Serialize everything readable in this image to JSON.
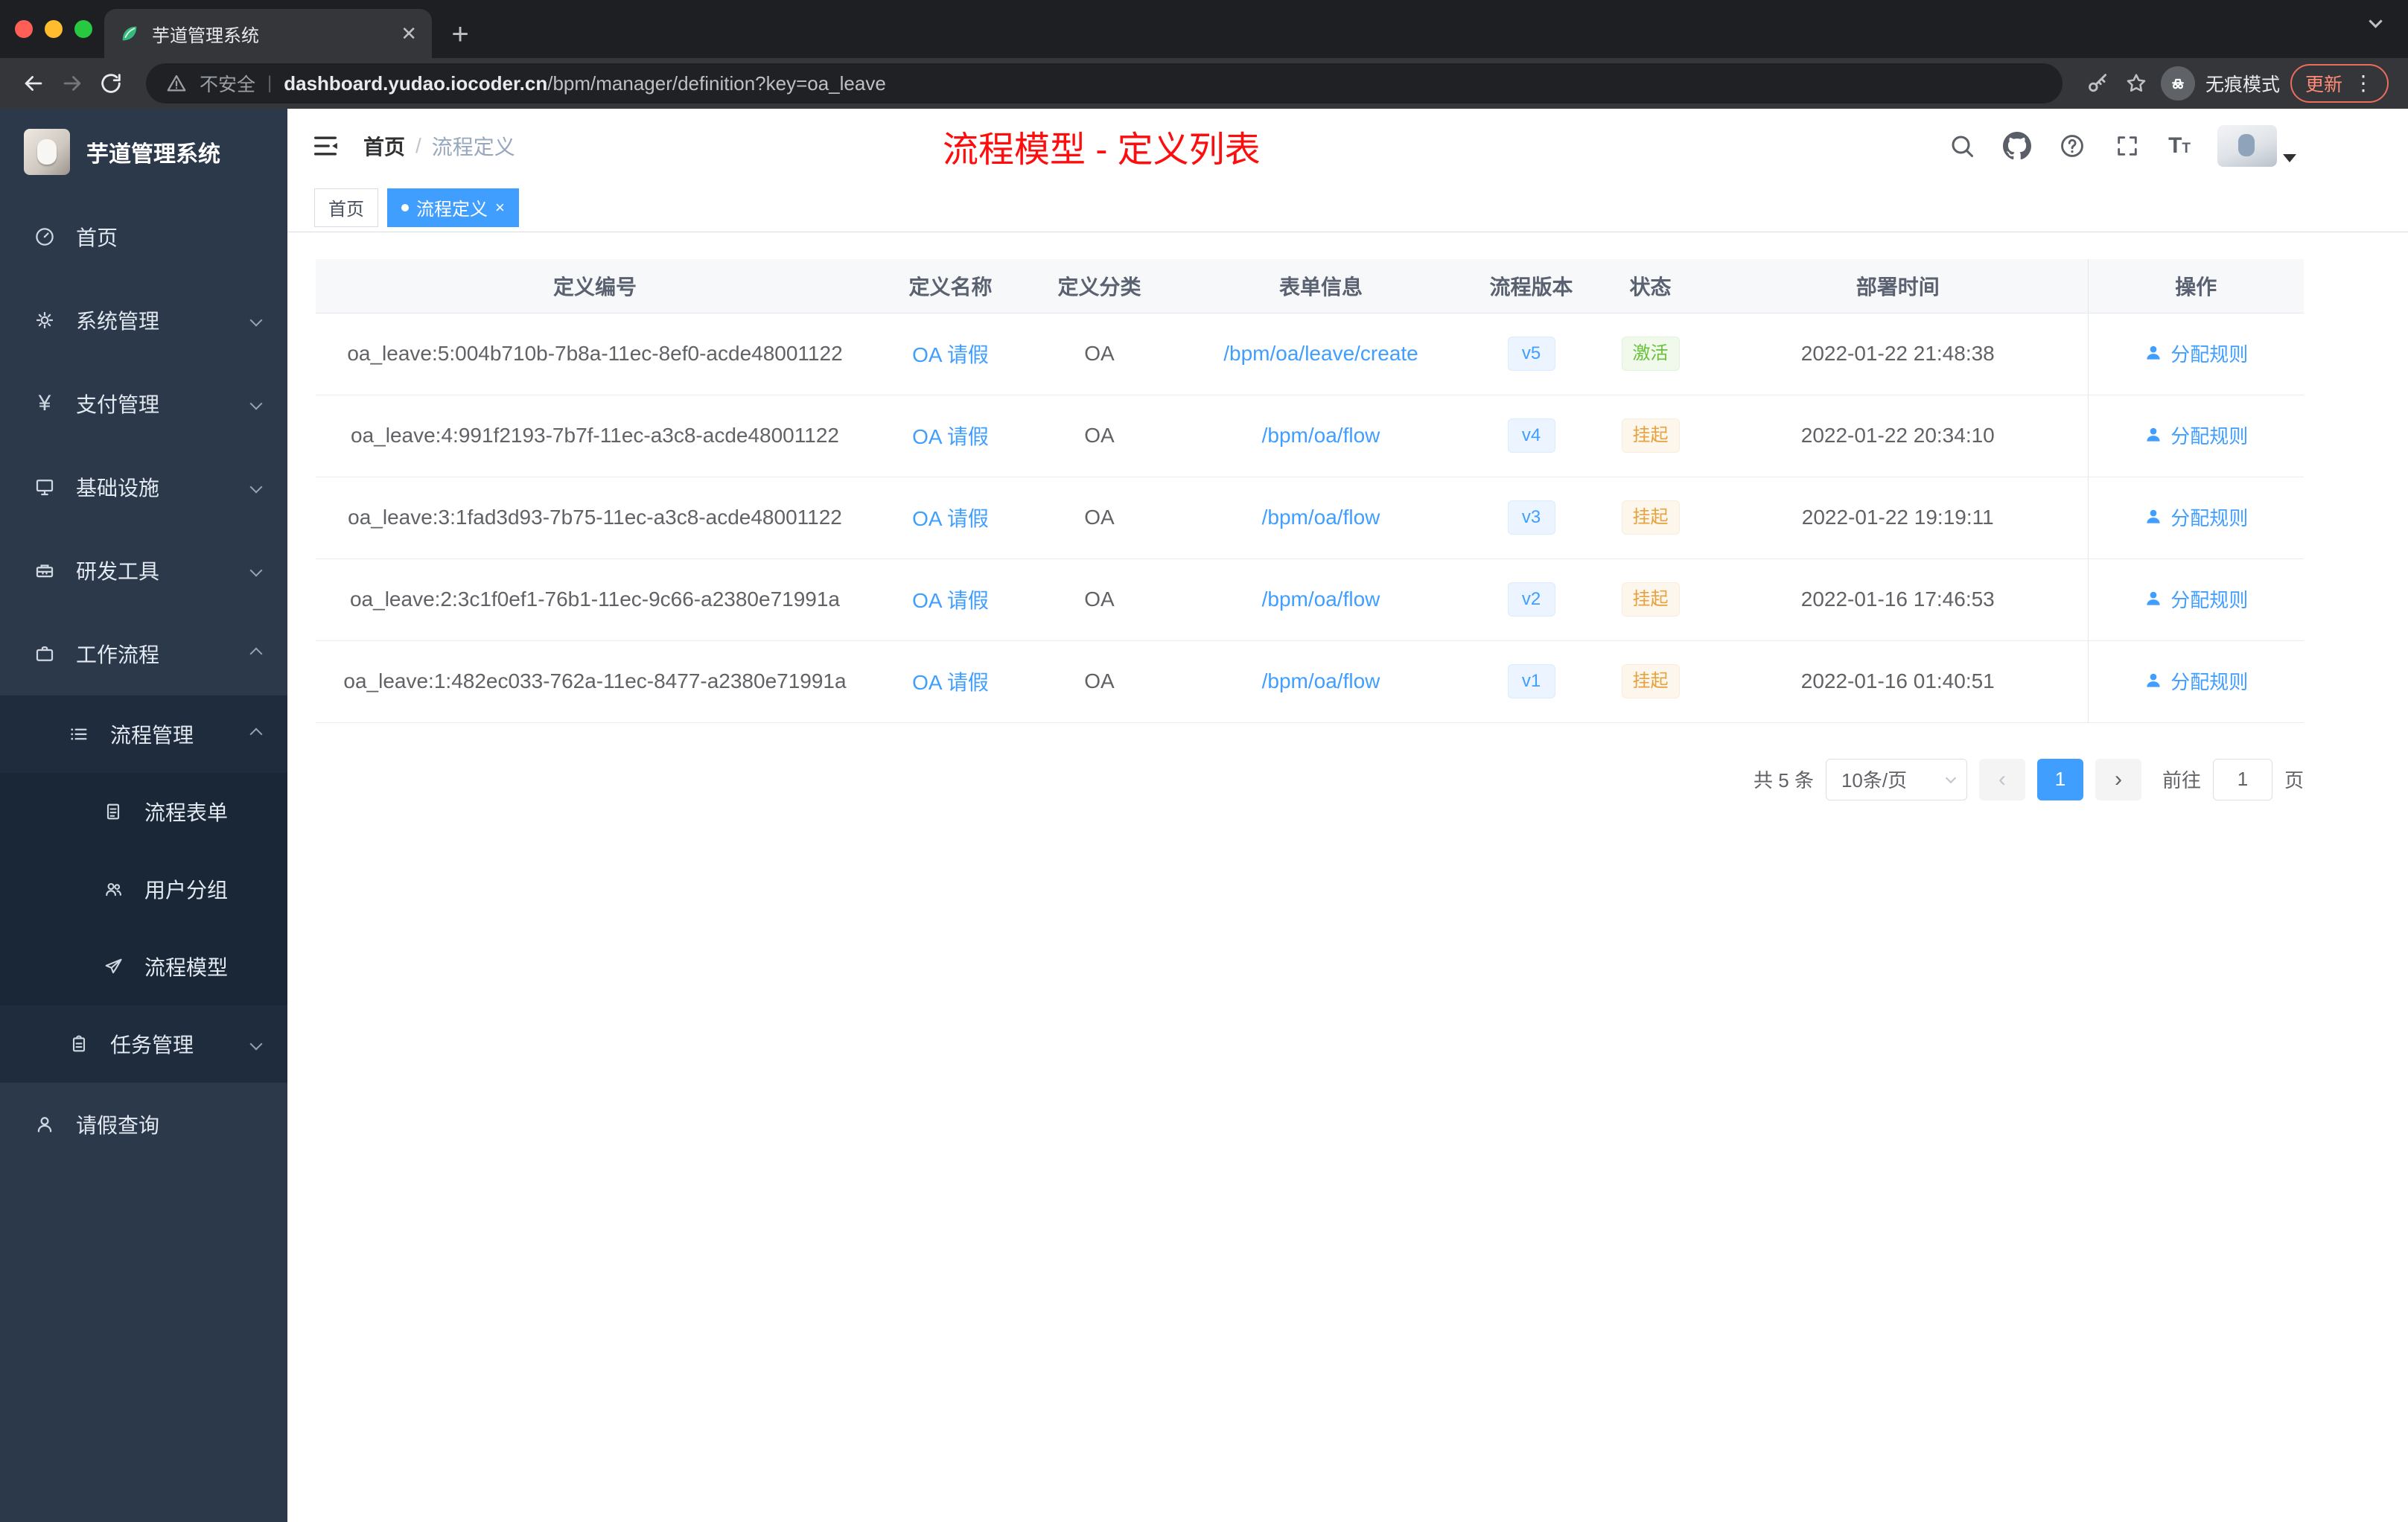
{
  "browser": {
    "tab_title": "芋道管理系统",
    "security_label": "不安全",
    "url_host": "dashboard.yudao.iocoder.cn",
    "url_path": "/bpm/manager/definition?key=oa_leave",
    "incognito_label": "无痕模式",
    "update_label": "更新"
  },
  "sidebar": {
    "logo_title": "芋道管理系统",
    "items": {
      "home": "首页",
      "system": "系统管理",
      "payment": "支付管理",
      "infra": "基础设施",
      "devtools": "研发工具",
      "workflow": "工作流程",
      "process_mgmt": "流程管理",
      "process_form": "流程表单",
      "user_group": "用户分组",
      "process_model": "流程模型",
      "task_mgmt": "任务管理",
      "leave_query": "请假查询"
    }
  },
  "navbar": {
    "breadcrumb_home": "首页",
    "breadcrumb_sep": "/",
    "breadcrumb_current": "流程定义",
    "annotation_title": "流程模型 - 定义列表"
  },
  "tags": {
    "home": "首页",
    "current": "流程定义"
  },
  "table": {
    "columns": [
      "定义编号",
      "定义名称",
      "定义分类",
      "表单信息",
      "流程版本",
      "状态",
      "部署时间",
      "操作"
    ],
    "rows": [
      {
        "id": "oa_leave:5:004b710b-7b8a-11ec-8ef0-acde48001122",
        "name": "OA 请假",
        "category": "OA",
        "form": "/bpm/oa/leave/create",
        "version": "v5",
        "status": "激活",
        "time": "2022-01-22 21:48:38",
        "action": "分配规则"
      },
      {
        "id": "oa_leave:4:991f2193-7b7f-11ec-a3c8-acde48001122",
        "name": "OA 请假",
        "category": "OA",
        "form": "/bpm/oa/flow",
        "version": "v4",
        "status": "挂起",
        "time": "2022-01-22 20:34:10",
        "action": "分配规则"
      },
      {
        "id": "oa_leave:3:1fad3d93-7b75-11ec-a3c8-acde48001122",
        "name": "OA 请假",
        "category": "OA",
        "form": "/bpm/oa/flow",
        "version": "v3",
        "status": "挂起",
        "time": "2022-01-22 19:19:11",
        "action": "分配规则"
      },
      {
        "id": "oa_leave:2:3c1f0ef1-76b1-11ec-9c66-a2380e71991a",
        "name": "OA 请假",
        "category": "OA",
        "form": "/bpm/oa/flow",
        "version": "v2",
        "status": "挂起",
        "time": "2022-01-16 17:46:53",
        "action": "分配规则"
      },
      {
        "id": "oa_leave:1:482ec033-762a-11ec-8477-a2380e71991a",
        "name": "OA 请假",
        "category": "OA",
        "form": "/bpm/oa/flow",
        "version": "v1",
        "status": "挂起",
        "time": "2022-01-16 01:40:51",
        "action": "分配规则"
      }
    ]
  },
  "pagination": {
    "total": "共 5 条",
    "page_size": "10条/页",
    "page": "1",
    "goto_label": "前往",
    "goto_value": "1",
    "unit_label": "页"
  }
}
